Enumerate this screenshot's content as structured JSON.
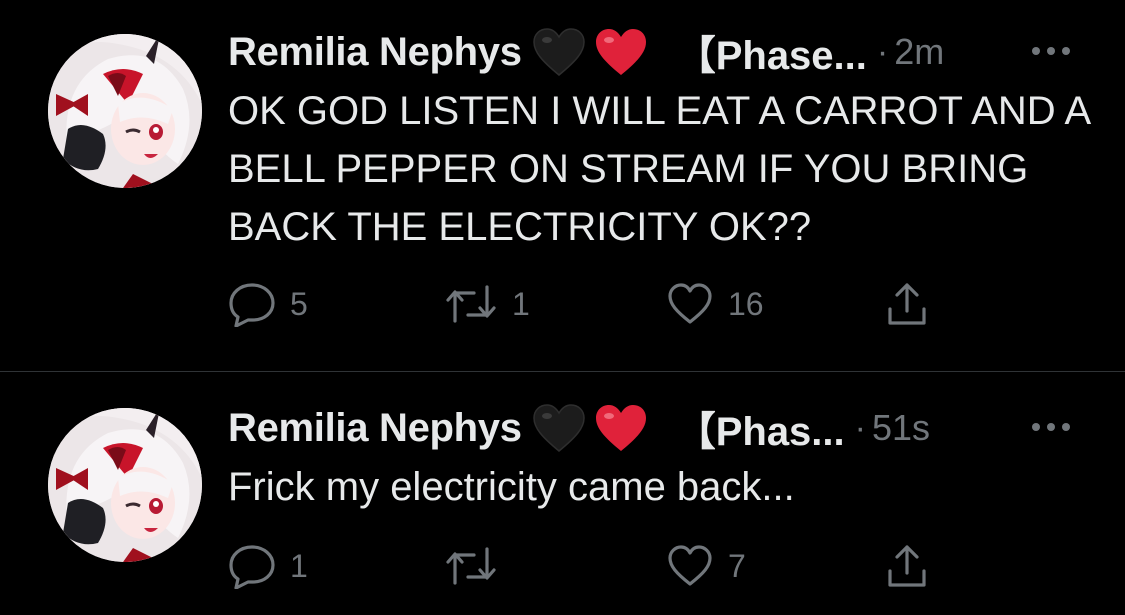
{
  "colors": {
    "background": "#000000",
    "text": "#e7e9ea",
    "muted": "#71767b",
    "divider": "#2f3336",
    "red_heart": "#e0223a",
    "black_heart": "#1c1c1c"
  },
  "tweets": [
    {
      "author": {
        "name": "Remilia Nephys",
        "emoji": [
          "black-heart",
          "red-heart"
        ],
        "name_suffix": "【Phase..."
      },
      "separator": "·",
      "time": "2m",
      "text": "OK GOD LISTEN I WILL EAT A CARROT AND A BELL PEPPER ON STREAM IF YOU BRING BACK THE ELECTRICITY OK??",
      "stats": {
        "replies": "5",
        "retweets": "1",
        "likes": "16"
      },
      "icons": [
        "reply-icon",
        "retweet-icon",
        "like-icon",
        "share-icon",
        "more-icon"
      ]
    },
    {
      "author": {
        "name": "Remilia Nephys",
        "emoji": [
          "black-heart",
          "red-heart"
        ],
        "name_suffix": "【Phas..."
      },
      "separator": "·",
      "time": "51s",
      "text": "Frick my electricity came back...",
      "stats": {
        "replies": "1",
        "retweets": "",
        "likes": "7"
      },
      "icons": [
        "reply-icon",
        "retweet-icon",
        "like-icon",
        "share-icon",
        "more-icon"
      ]
    }
  ]
}
